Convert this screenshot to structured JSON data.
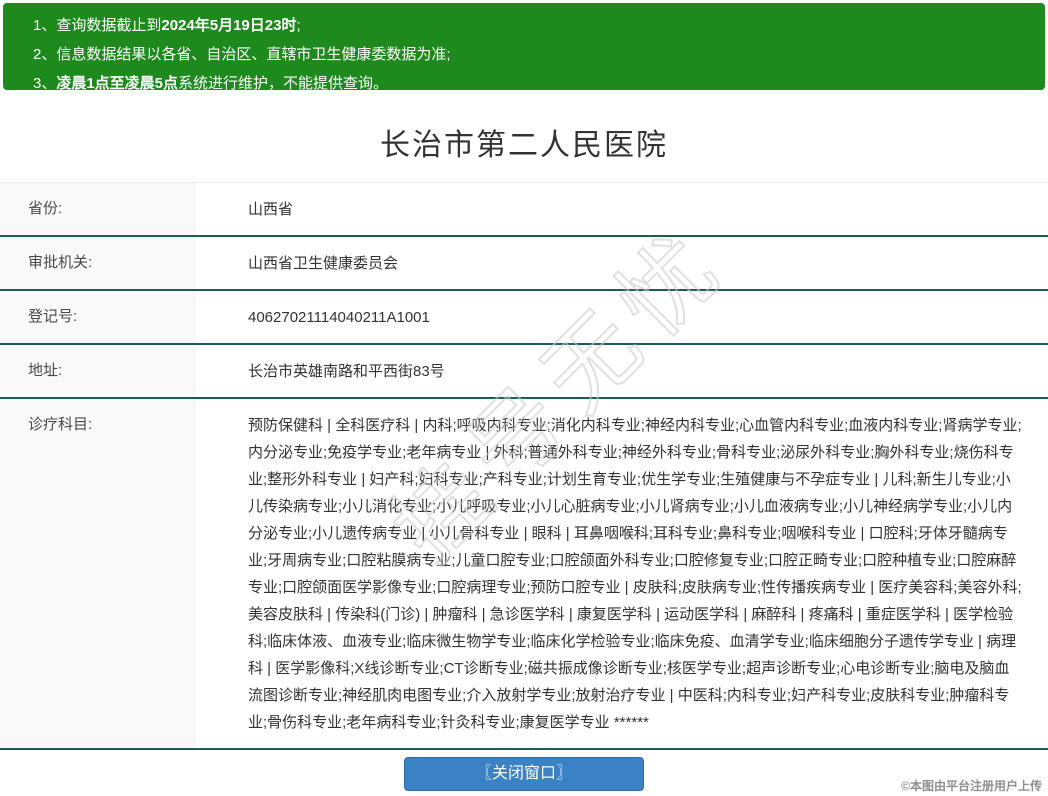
{
  "banner": {
    "items": [
      {
        "num": "1、",
        "pre": "查询数据截止到",
        "bold": "2024年5月19日23时",
        "post": ";"
      },
      {
        "num": "2、",
        "pre": "信息数据结果以各省、自治区、直辖市卫生健康委数据为准;",
        "bold": "",
        "post": ""
      },
      {
        "num": "3、",
        "pre": "",
        "bold": "凌晨1点至凌晨5点",
        "post": "系统进行维护，不能提供查询。"
      }
    ]
  },
  "header": {
    "title": "长治市第二人民医院"
  },
  "table": {
    "rows": [
      {
        "label": "省份:",
        "value": "山西省"
      },
      {
        "label": "审批机关:",
        "value": "山西省卫生健康委员会"
      },
      {
        "label": "登记号:",
        "value": "40627021114040211A1001"
      },
      {
        "label": "地址:",
        "value": "长治市英雄南路和平西街83号"
      },
      {
        "label": "诊疗科目:",
        "value": "预防保健科 | 全科医疗科 | 内科;呼吸内科专业;消化内科专业;神经内科专业;心血管内科专业;血液内科专业;肾病学专业;内分泌专业;免疫学专业;老年病专业 | 外科;普通外科专业;神经外科专业;骨科专业;泌尿外科专业;胸外科专业;烧伤科专业;整形外科专业 | 妇产科;妇科专业;产科专业;计划生育专业;优生学专业;生殖健康与不孕症专业 | 儿科;新生儿专业;小儿传染病专业;小儿消化专业;小儿呼吸专业;小儿心脏病专业;小儿肾病专业;小儿血液病专业;小儿神经病学专业;小儿内分泌专业;小儿遗传病专业 | 小儿骨科专业 | 眼科 | 耳鼻咽喉科;耳科专业;鼻科专业;咽喉科专业 | 口腔科;牙体牙髓病专业;牙周病专业;口腔粘膜病专业;儿童口腔专业;口腔颌面外科专业;口腔修复专业;口腔正畸专业;口腔种植专业;口腔麻醉专业;口腔颌面医学影像专业;口腔病理专业;预防口腔专业 | 皮肤科;皮肤病专业;性传播疾病专业 | 医疗美容科;美容外科;美容皮肤科 | 传染科(门诊) | 肿瘤科 | 急诊医学科 | 康复医学科 | 运动医学科 | 麻醉科 | 疼痛科 | 重症医学科 | 医学检验科;临床体液、血液专业;临床微生物学专业;临床化学检验专业;临床免疫、血清学专业;临床细胞分子遗传学专业 | 病理科 | 医学影像科;X线诊断专业;CT诊断专业;磁共振成像诊断专业;核医学专业;超声诊断专业;心电诊断专业;脑电及脑血流图诊断专业;神经肌肉电图专业;介入放射学专业;放射治疗专业 | 中医科;内科专业;妇产科专业;皮肤科专业;肿瘤科专业;骨伤科专业;老年病科专业;针灸科专业;康复医学专业 ******"
      }
    ]
  },
  "watermark": {
    "text": "挂号无忧"
  },
  "footer": {
    "close_button_label": "〖关闭窗口〗",
    "upload_note": "©本图由平台注册用户上传"
  },
  "colors": {
    "banner_green": "#1e8a1e",
    "divider_teal": "#1c5c52",
    "button_blue": "#3b82c4"
  }
}
